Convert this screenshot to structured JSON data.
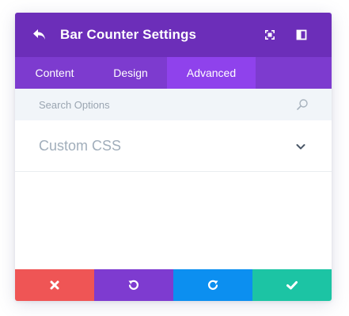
{
  "header": {
    "title": "Bar Counter Settings",
    "icons": [
      "back-arrow-icon",
      "fullscreen-icon",
      "sidebar-toggle-icon"
    ]
  },
  "tabs": [
    {
      "label": "Content",
      "active": false
    },
    {
      "label": "Design",
      "active": false
    },
    {
      "label": "Advanced",
      "active": true
    }
  ],
  "search": {
    "placeholder": "Search Options",
    "value": ""
  },
  "sections": [
    {
      "title": "Custom CSS",
      "expanded": false
    }
  ],
  "footer": {
    "buttons": [
      {
        "name": "cancel",
        "icon": "close-icon",
        "color": "#ef5555"
      },
      {
        "name": "undo",
        "icon": "undo-icon",
        "color": "#7e3bd0"
      },
      {
        "name": "redo",
        "icon": "redo-icon",
        "color": "#0c8ff0"
      },
      {
        "name": "save",
        "icon": "check-icon",
        "color": "#1cc4a4"
      }
    ]
  },
  "colors": {
    "header": "#6c2eb9",
    "tabs": "#7d3bcf",
    "tab_active": "#8f42ec",
    "search_bg": "#f1f5f9"
  }
}
